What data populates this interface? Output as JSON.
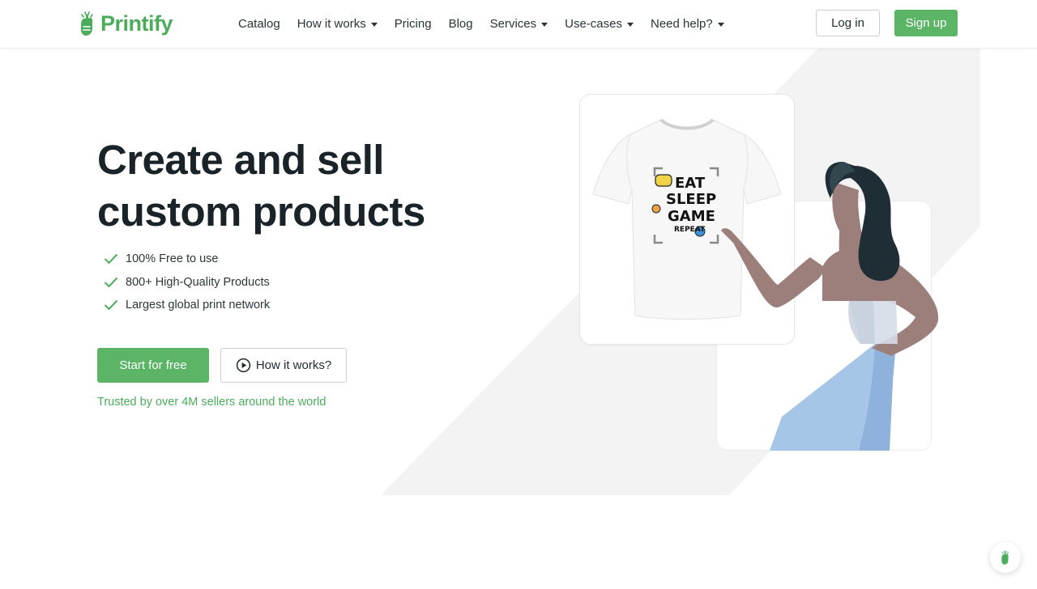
{
  "header": {
    "logo_text": "Printify",
    "nav": [
      {
        "label": "Catalog",
        "dropdown": false
      },
      {
        "label": "How it works",
        "dropdown": true
      },
      {
        "label": "Pricing",
        "dropdown": false
      },
      {
        "label": "Blog",
        "dropdown": false
      },
      {
        "label": "Services",
        "dropdown": true
      },
      {
        "label": "Use-cases",
        "dropdown": true
      },
      {
        "label": "Need help?",
        "dropdown": true
      }
    ],
    "login_label": "Log in",
    "signup_label": "Sign up"
  },
  "hero": {
    "title_line1": "Create and sell",
    "title_line2": "custom products",
    "features": [
      "100% Free to use",
      "800+ High-Quality Products",
      "Largest global print network"
    ],
    "start_button": "Start for free",
    "how_button": "How it works?",
    "trusted": "Trusted by over 4M sellers around the world"
  },
  "illustration": {
    "shirt_print": [
      "EAT",
      "SLEEP",
      "GAME",
      "REPEAT"
    ]
  },
  "colors": {
    "brand_green": "#5cb566",
    "text_dark": "#1a2328",
    "skirt_blue": "#a6c6e8",
    "skin": "#9c7f7a",
    "hair": "#1f2e35"
  },
  "icons": {
    "logo": "printify-hand-icon",
    "check": "check-icon",
    "play": "play-circle-icon",
    "chat": "printify-chat-icon"
  }
}
